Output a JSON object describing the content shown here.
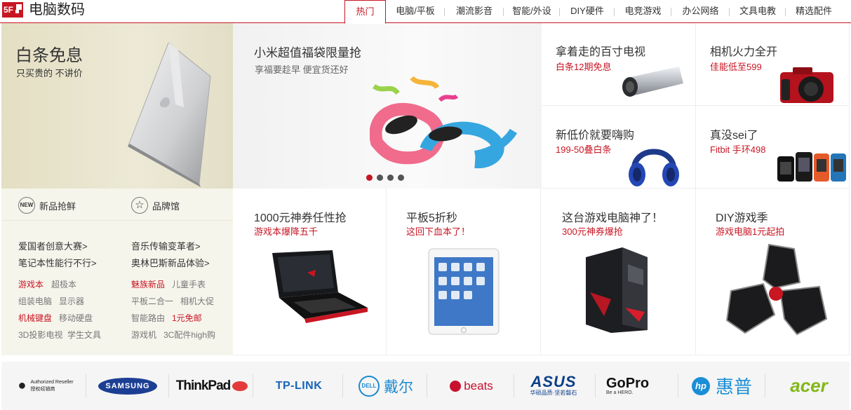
{
  "header": {
    "logo_text": "5F",
    "title": "电脑数码",
    "tabs": [
      "热门",
      "电脑/平板",
      "潮流影音",
      "智能/外设",
      "DIY硬件",
      "电竞游戏",
      "办公网络",
      "文具电教",
      "精选配件"
    ],
    "accent": "#c81623"
  },
  "hero_left": {
    "title": "白条免息",
    "subtitle": "只买贵的 不讲价"
  },
  "hero_center": {
    "title": "小米超值福袋限量抢",
    "subtitle": "享福要趁早 便宜货还好",
    "slides": 4,
    "active_slide": 1
  },
  "promo_tiles": [
    {
      "title": "拿着走的百寸电视",
      "subtitle": "白条12期免息",
      "icon": "projector-icon"
    },
    {
      "title": "相机火力全开",
      "subtitle": "佳能低至599",
      "icon": "camera-icon"
    },
    {
      "title": "新低价就要嗨购",
      "subtitle": "199-50叠白条",
      "icon": "headphones-icon"
    },
    {
      "title": "真没sei了",
      "subtitle": "Fitbit 手环498",
      "icon": "smartwatch-icon"
    },
    {
      "title": "1000元神券任性抢",
      "subtitle": "游戏本爆降五千",
      "icon": "gaming-laptop-icon"
    },
    {
      "title": "平板5折秒",
      "subtitle": "这回下血本了！",
      "icon": "tablet-icon"
    },
    {
      "title": "这台游戏电脑神了！",
      "subtitle": "300元神券爆抢",
      "icon": "gaming-pc-icon"
    },
    {
      "title": "DIY游戏季",
      "subtitle": "游戏电脑1元起拍",
      "icon": "pc-case-icon"
    }
  ],
  "sidebar": {
    "head": [
      {
        "badge": "NEW",
        "label": "新品抢鲜"
      },
      {
        "badge": "☆",
        "label": "品牌馆"
      }
    ],
    "links": [
      "爱国者创意大赛>",
      "音乐传输变革者>",
      "笔记本性能行不行>",
      "奥林巴斯新品体验>"
    ],
    "keywords": [
      {
        "text": "游戏本",
        "hot": true
      },
      {
        "text": "超极本",
        "hot": false
      },
      {
        "text": "魅族新品",
        "hot": true
      },
      {
        "text": "儿童手表",
        "hot": false
      },
      {
        "text": "组装电脑",
        "hot": false
      },
      {
        "text": "显示器",
        "hot": false
      },
      {
        "text": "平板二合一",
        "hot": false
      },
      {
        "text": "相机大促",
        "hot": false
      },
      {
        "text": "机械键盘",
        "hot": true
      },
      {
        "text": "移动硬盘",
        "hot": false
      },
      {
        "text": "智能路由",
        "hot": false
      },
      {
        "text": "1元免邮",
        "hot": true
      },
      {
        "text": "3D投影电视",
        "hot": false
      },
      {
        "text": "学生文具",
        "hot": false
      },
      {
        "text": "游戏机",
        "hot": false
      },
      {
        "text": "3C配件high购",
        "hot": false
      }
    ]
  },
  "brands": [
    {
      "name": "Apple",
      "line1": "Authorized Reseller",
      "line2": "授权经销商"
    },
    {
      "name": "SAMSUNG"
    },
    {
      "name": "ThinkPad"
    },
    {
      "name": "TP-LINK"
    },
    {
      "name": "DELL",
      "cn": "戴尔"
    },
    {
      "name": "beats"
    },
    {
      "name": "ASUS",
      "cn": "华硕品质·坚若磐石"
    },
    {
      "name": "GoPro",
      "tag": "Be a HERO."
    },
    {
      "name": "hp",
      "cn": "惠普"
    },
    {
      "name": "acer"
    }
  ]
}
